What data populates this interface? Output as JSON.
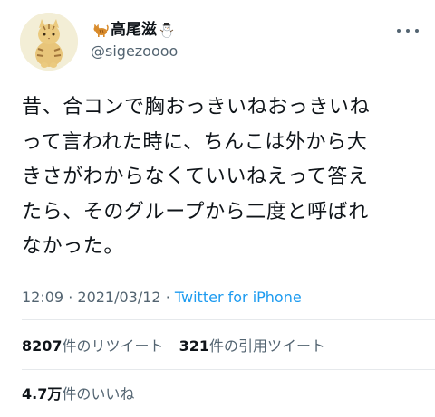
{
  "author": {
    "display_name": "高尾滋",
    "handle": "@sigezoooo",
    "prefix_icon": "cat-emoji-icon",
    "suffix_icon": "snowman-emoji-icon"
  },
  "tweet": {
    "text": "昔、合コンで胸おっきいねおっきいね\nって言われた時に、ちんこは外から大\nきさがわからなくていいねえって答え\nたら、そのグループから二度と呼ばれ\nなかった。"
  },
  "meta": {
    "time": "12:09",
    "separator": "·",
    "date": "2021/03/12",
    "source": "Twitter for iPhone"
  },
  "stats": {
    "retweets_count": "8207",
    "retweets_label": "件のリツイート",
    "quotes_count": "321",
    "quotes_label": "件の引用ツイート",
    "likes_count": "4.7万",
    "likes_label": "件のいいね"
  },
  "colors": {
    "text": "#0f1419",
    "secondary": "#536471",
    "link": "#1d9bf0",
    "divider": "#e6e9ec"
  }
}
